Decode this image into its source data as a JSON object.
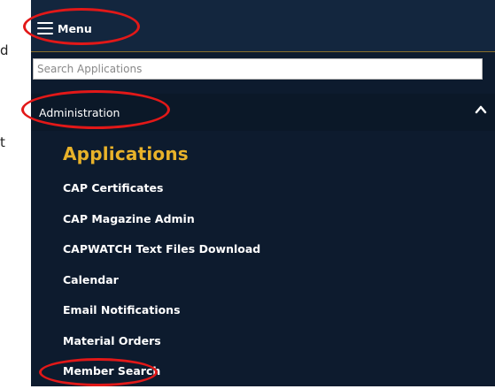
{
  "background": {
    "fragments": [
      "d",
      "t"
    ]
  },
  "menu": {
    "label": "Menu",
    "icon": "hamburger-icon"
  },
  "search": {
    "placeholder": "Search Applications"
  },
  "section": {
    "label": "Administration",
    "icon": "chevron-up-icon"
  },
  "applications": {
    "heading": "Applications",
    "items": [
      "CAP Certificates",
      "CAP Magazine Admin",
      "CAPWATCH Text Files Download",
      "Calendar",
      "Email Notifications",
      "Material Orders",
      "Member Search"
    ]
  },
  "colors": {
    "panel": "#0d1b2e",
    "heading": "#e8b22a",
    "highlight": "#e21818"
  }
}
